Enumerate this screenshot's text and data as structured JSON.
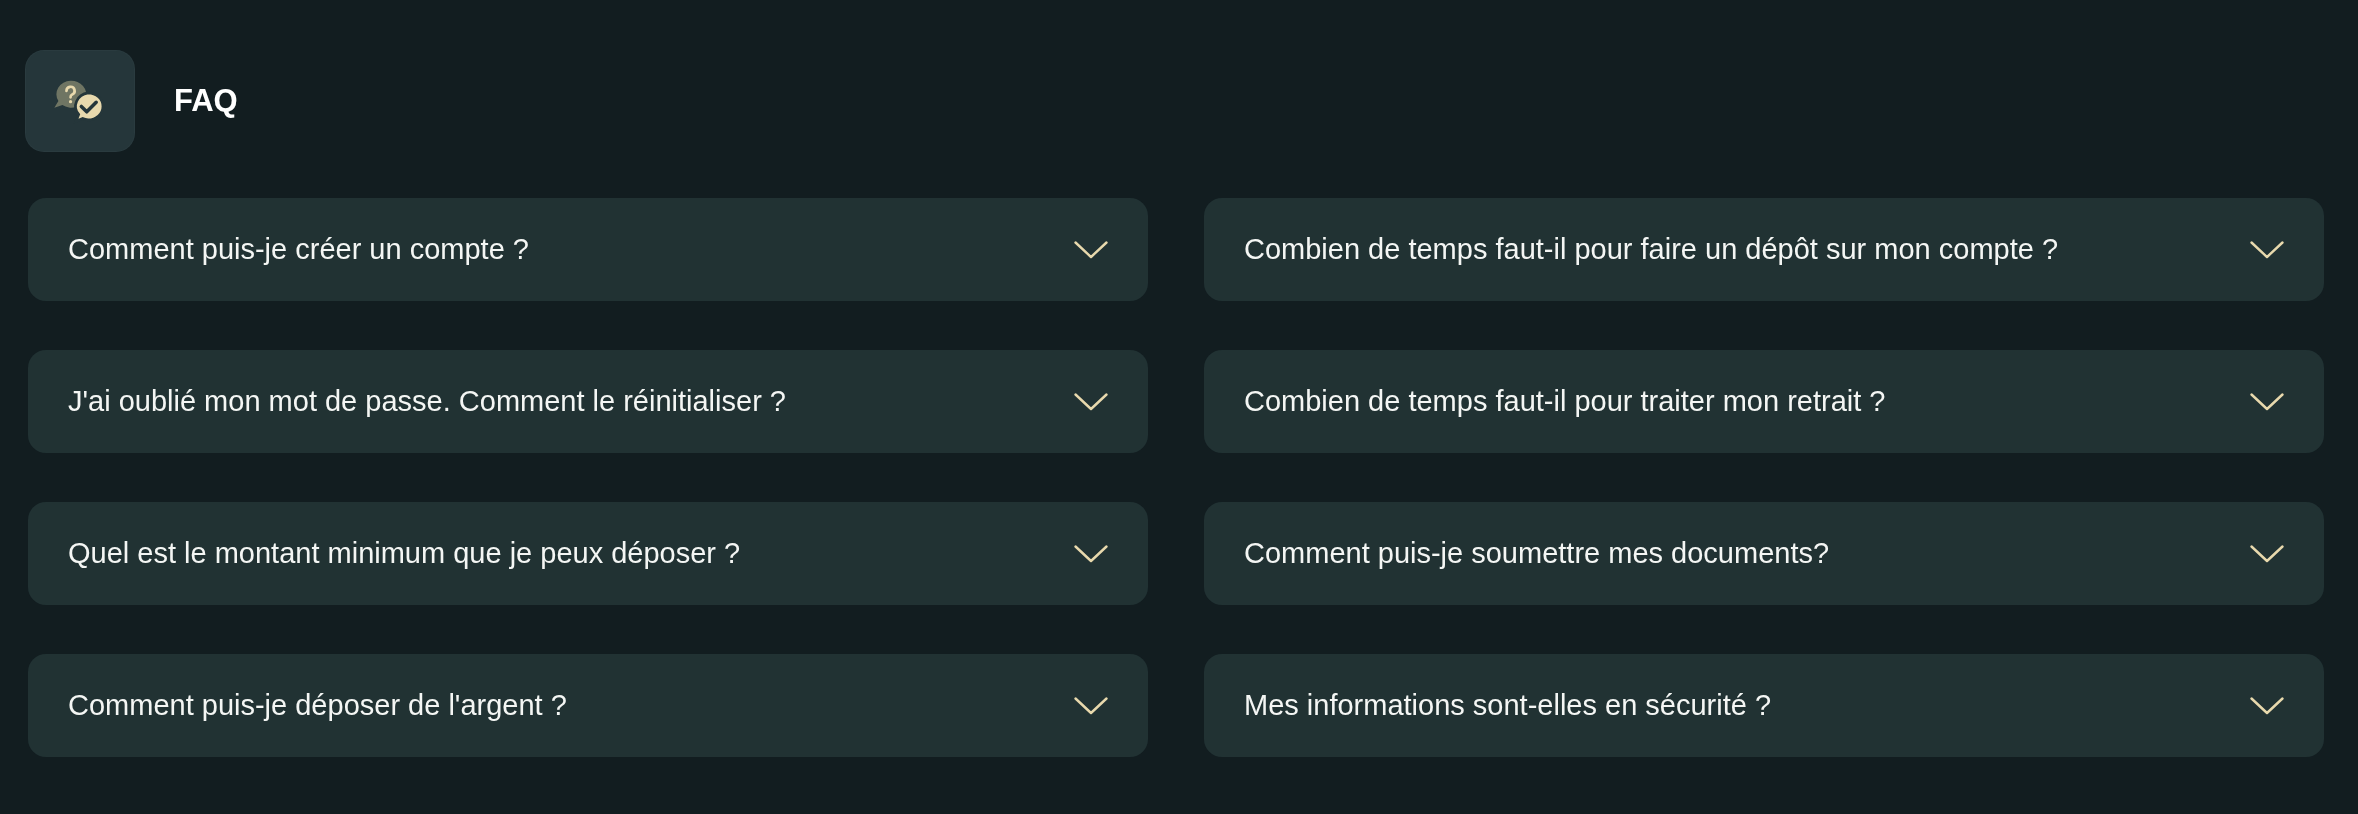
{
  "header": {
    "title": "FAQ"
  },
  "faq": [
    {
      "question": "Comment puis-je créer un compte ?",
      "expanded": false
    },
    {
      "question": "Combien de temps faut-il pour faire un dépôt sur mon compte ?",
      "expanded": false
    },
    {
      "question": "J'ai oublié mon mot de passe. Comment le réinitialiser ?",
      "expanded": false
    },
    {
      "question": "Combien de temps faut-il pour traiter mon retrait ?",
      "expanded": false
    },
    {
      "question": "Quel est le montant minimum que je peux déposer ?",
      "expanded": false
    },
    {
      "question": "Comment puis-je soumettre mes documents?",
      "expanded": false
    },
    {
      "question": "Comment puis-je déposer de l'argent ?",
      "expanded": false
    },
    {
      "question": "Mes informations sont-elles en sécurité ?",
      "expanded": false
    }
  ]
}
